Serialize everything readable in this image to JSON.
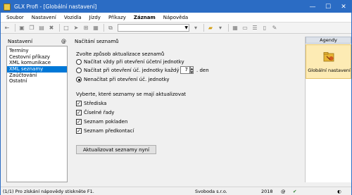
{
  "window": {
    "title": "GLX Profi - [Globální nastavení]"
  },
  "titlebar_buttons": {
    "minimize": "—",
    "maximize": "☐",
    "close": "✕"
  },
  "menu": [
    "Soubor",
    "Nastavení",
    "Vozidla",
    "Jízdy",
    "Příkazy",
    "Záznam",
    "Nápověda"
  ],
  "toolbar": {
    "combo_value": ""
  },
  "left_panel": {
    "caption": "Nastavení",
    "pin": "@",
    "items": [
      "Termíny",
      "Cestovní příkazy",
      "XML komunikace",
      "XML seznamy",
      "Zaúčtování",
      "Ostatní"
    ],
    "selected": "XML seznamy"
  },
  "content": {
    "section_title": "Načítání seznamů",
    "mode_label": "Zvolte způsob aktualizace seznamů",
    "radios": [
      {
        "label": "Načítat vždy při otevření účetní jednotky",
        "checked": false
      },
      {
        "label": "Načítat při otevření úč. jednotky každý",
        "checked": false
      },
      {
        "label": "Nenačítat při otevření úč. jednotky",
        "checked": true
      }
    ],
    "days_value": "7",
    "days_unit": ". den",
    "lists_label": "Vyberte, které seznamy se mají aktualizovat",
    "checks": [
      {
        "label": "Střediska",
        "checked": true
      },
      {
        "label": "Číselné řady",
        "checked": true
      },
      {
        "label": "Seznam pokladen",
        "checked": true
      },
      {
        "label": "Seznam předkontací",
        "checked": true
      }
    ],
    "update_button": "Aktualizovat seznamy nyní"
  },
  "agenda": {
    "header": "Agendy",
    "item_label": "Globální nastavení"
  },
  "statusbar": {
    "help": "(1/1) Pro získání nápovědy stiskněte F1.",
    "company": "Svoboda s.r.o.",
    "year": "2018",
    "at": "@"
  }
}
